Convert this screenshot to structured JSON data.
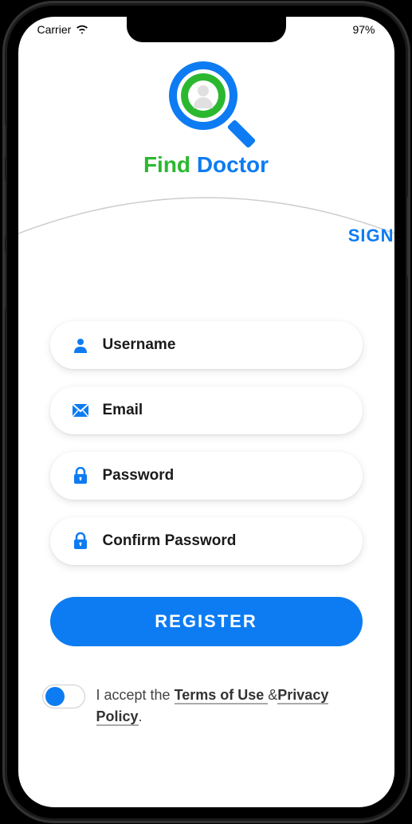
{
  "statusBar": {
    "carrier": "Carrier",
    "battery": "97%"
  },
  "logo": {
    "word1": "Find",
    "word2": "Doctor"
  },
  "signLink": "SIGN",
  "fields": {
    "username": {
      "placeholder": "Username"
    },
    "email": {
      "placeholder": "Email"
    },
    "password": {
      "placeholder": "Password"
    },
    "confirmPassword": {
      "placeholder": "Confirm Password"
    }
  },
  "registerButton": "REGISTER",
  "terms": {
    "prefix": "I accept the ",
    "termsOfUse": "Terms of Use ",
    "and": "&",
    "privacyPolicy": "Privacy Policy",
    "suffix": "."
  }
}
